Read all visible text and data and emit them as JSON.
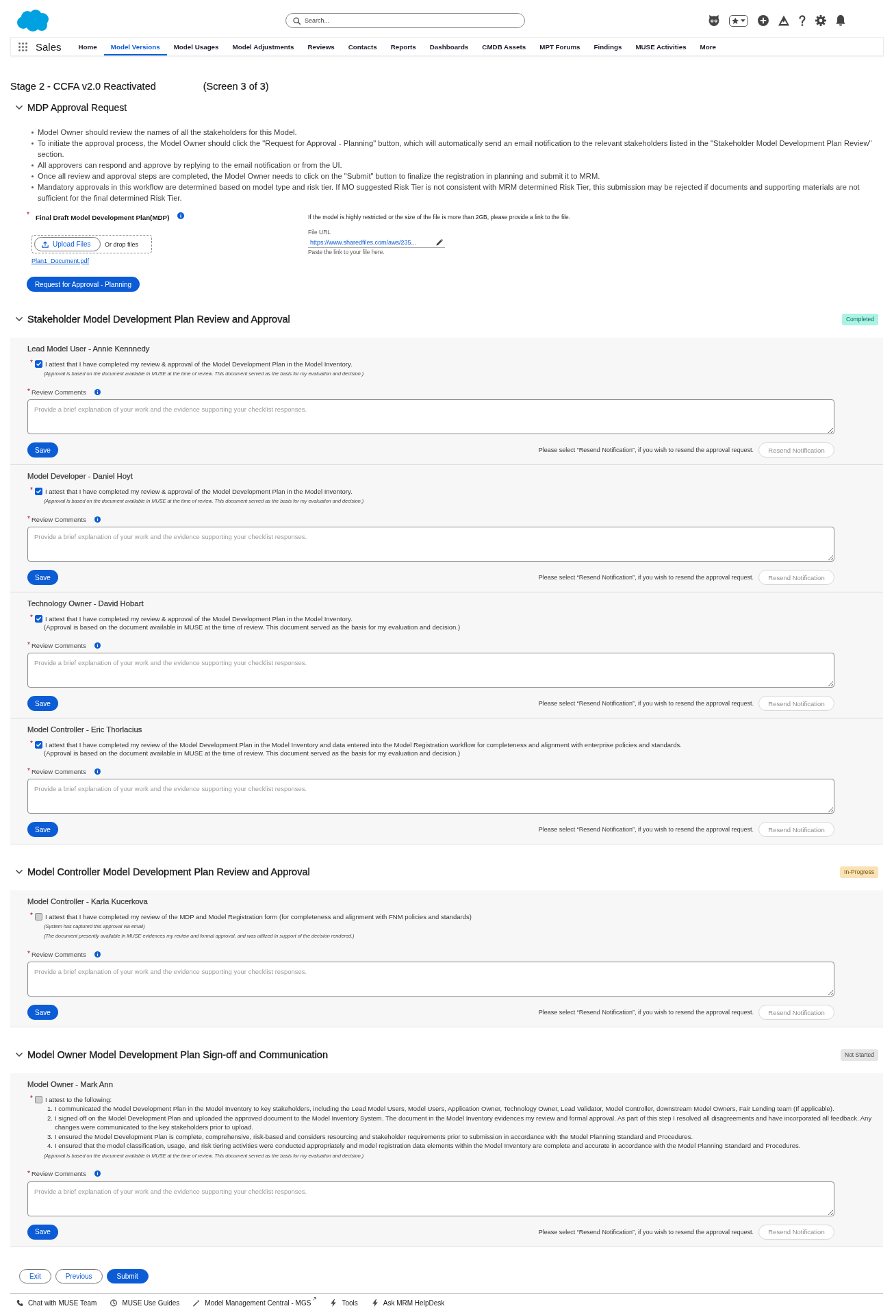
{
  "header": {
    "search": {
      "placeholder": "Search..."
    }
  },
  "nav": {
    "app_name": "Sales",
    "tabs": [
      {
        "label": "Home",
        "selected": false
      },
      {
        "label": "Model Versions",
        "selected": true
      },
      {
        "label": "Model Usages",
        "selected": false
      },
      {
        "label": "Model Adjustments",
        "selected": false
      },
      {
        "label": "Reviews",
        "selected": false
      },
      {
        "label": "Contacts",
        "selected": false
      },
      {
        "label": "Reports",
        "selected": false
      },
      {
        "label": "Dashboards",
        "selected": false
      },
      {
        "label": "CMDB Assets",
        "selected": false
      },
      {
        "label": "MPT Forums",
        "selected": false
      },
      {
        "label": "Findings",
        "selected": false
      },
      {
        "label": "MUSE Activities",
        "selected": false
      },
      {
        "label": "More",
        "selected": false
      }
    ]
  },
  "page": {
    "title": "Stage 2 - CCFA v2.0 Reactivated",
    "screen": "(Screen 3 of 3)"
  },
  "mdp_section": {
    "title": "MDP Approval Request",
    "expanded": true,
    "bullets": [
      "Model Owner should review the names of all the stakeholders for this Model.",
      "To initiate the approval process, the Model Owner should click the \"Request for Approval - Planning\" button, which will automatically send an email notification to the relevant stakeholders listed in the \"Stakeholder Model Development Plan Review\" section.",
      "All approvers can respond and approve by replying to the email notification or from the UI.",
      "Once all review and approval steps are completed, the Model Owner needs to click on the \"Submit\" button to finalize the registration in planning and submit it to MRM.",
      "Mandatory approvals in this workflow are determined based on model type and risk tier. If MO suggested Risk Tier is not consistent with MRM determined Risk Tier, this submission may be rejected if documents and supporting materials are not sufficient for the final determined Risk Tier."
    ],
    "upload": {
      "required_mark": "*",
      "label": "Final Draft Model Development Plan(MDP)",
      "button": "Upload Files",
      "drop_hint": "Or drop files",
      "file": "Plan1_Document.pdf"
    },
    "file_url": {
      "hint": "If the model is highly restricted or the size of the file is more than 2GB, please provide a link to the file.",
      "label": "File URL",
      "value": "https://www.sharedfiles.com/aws/235...",
      "help": "Paste the link to your file here."
    },
    "request_button": "Request for Approval - Planning"
  },
  "approval_sections": [
    {
      "title": "Stakeholder Model Development Plan Review and Approval",
      "expanded": true,
      "status": {
        "label": "Completed",
        "kind": "completed"
      },
      "reviewers": [
        {
          "title": "Lead Model User - Annie Kennnedy",
          "attest": {
            "required_mark": "*",
            "checked": true,
            "text": "I attest that I have completed my review & approval of the Model Development Plan in the Model Inventory."
          },
          "notes": [
            {
              "kind": "fine-print",
              "text": "(Approval is based on the document available in MUSE at the time of review. This document served as the basis for my evaluation and decision.)"
            }
          ],
          "comments": {
            "required_mark": "*",
            "label": "Review Comments",
            "placeholder": "Provide a brief explanation of your work and the evidence supporting your checklist responses."
          },
          "save_button": "Save",
          "resend_hint": "Please select “Resend Notification”, if you wish to resend the approval request.",
          "resend_button": {
            "label": "Resend Notification",
            "disabled": true
          }
        },
        {
          "title": "Model Developer - Daniel Hoyt",
          "attest": {
            "required_mark": "*",
            "checked": true,
            "text": "I attest that I have completed my review & approval of the Model Development Plan in the Model Inventory."
          },
          "notes": [
            {
              "kind": "fine-print",
              "text": "(Approval is based on the document available in MUSE at the time of review. This document served as the basis for my evaluation and decision.)"
            }
          ],
          "comments": {
            "required_mark": "*",
            "label": "Review Comments",
            "placeholder": "Provide a brief explanation of your work and the evidence supporting your checklist responses."
          },
          "save_button": "Save",
          "resend_hint": "Please select “Resend Notification”, if you wish to resend the approval request.",
          "resend_button": {
            "label": "Resend Notification",
            "disabled": true
          }
        },
        {
          "title": "Technology Owner - David Hobart",
          "attest": {
            "required_mark": "*",
            "checked": true,
            "text": "I attest that I have completed my review & approval of the Model Development Plan in the Model Inventory."
          },
          "notes": [
            {
              "kind": "plain",
              "text": "(Approval is based on the document available in MUSE at the time of review. This document served as the basis for my evaluation and decision.)"
            }
          ],
          "comments": {
            "required_mark": "*",
            "label": "Review Comments",
            "placeholder": "Provide a brief explanation of your work and the evidence supporting your checklist responses."
          },
          "save_button": "Save",
          "resend_hint": "Please select “Resend Notification”, if you wish to resend the approval request.",
          "resend_button": {
            "label": "Resend Notification",
            "disabled": true
          }
        },
        {
          "title": "Model Controller - Eric Thorlacius",
          "attest": {
            "required_mark": "*",
            "checked": true,
            "text": "I attest that I have completed my review of the Model Development Plan in the Model Inventory and data entered into the Model Registration workflow for completeness and alignment with enterprise policies and standards."
          },
          "notes": [
            {
              "kind": "plain",
              "text": "(Approval is based on the document available in MUSE at the time of review. This document served as the basis for my evaluation and decision.)"
            }
          ],
          "comments": {
            "required_mark": "*",
            "label": "Review Comments",
            "placeholder": "Provide a brief explanation of your work and the evidence supporting your checklist responses."
          },
          "save_button": "Save",
          "resend_hint": "Please select “Resend Notification”, if you wish to resend the approval request.",
          "resend_button": {
            "label": "Resend Notification",
            "disabled": true
          }
        }
      ]
    },
    {
      "title": "Model Controller Model Development Plan Review and Approval",
      "expanded": true,
      "status": {
        "label": "In-Progress",
        "kind": "in-progress"
      },
      "reviewers": [
        {
          "title": "Model Controller - Karla Kucerkova",
          "attest": {
            "required_mark": "*",
            "checked": false,
            "text": "I attest that I have completed my review of the MDP and Model Registration form (for completeness and alignment with FNM policies and standards)"
          },
          "notes": [
            {
              "kind": "fine-print",
              "text": "(System has captured this approval via email)"
            },
            {
              "kind": "fine-print",
              "text": "(The document presently available in MUSE evidences my review and formal approval, and was utilized in support of the decision rendered.)"
            }
          ],
          "comments": {
            "required_mark": "*",
            "label": "Review Comments",
            "placeholder": "Provide a brief explanation of your work and the evidence supporting your checklist responses."
          },
          "save_button": "Save",
          "resend_hint": "Please select “Resend Notification”, if you wish to resend the approval request.",
          "resend_button": {
            "label": "Resend Notification",
            "disabled": true
          }
        }
      ]
    },
    {
      "title": "Model Owner Model Development Plan Sign-off and Communication",
      "expanded": true,
      "status": {
        "label": "Not Started",
        "kind": "not-started"
      },
      "reviewers": [
        {
          "title": "Model Owner - Mark Ann",
          "attest": {
            "required_mark": "*",
            "checked": false,
            "text": "I attest to the following:",
            "items": [
              {
                "number": "1.",
                "text": "I communicated the Model Development Plan in the Model Inventory to key stakeholders, including the Lead Model Users, Model Users, Application Owner, Technology Owner, Lead Validator, Model Controller, downstream Model Owners, Fair Lending team (If applicable)."
              },
              {
                "number": "2.",
                "text": "I signed off on the Model Development Plan and uploaded the approved document to the Model Inventory System. The document in the Model Inventory evidences my review and formal approval. As part of this step I resolved all disagreements and have incorporated all feedback. Any changes were communicated to the key stakeholders prior to upload."
              },
              {
                "number": "3.",
                "text": "I ensured the Model Development Plan is complete, comprehensive, risk-based and considers resourcing and stakeholder requirements prior to submission in accordance with the Model Planning Standard and Procedures."
              },
              {
                "number": "4.",
                "text": "I ensured that the model classification, usage, and risk tiering activities were conducted appropriately and model registration data elements within the Model Inventory are complete and accurate in accordance with the Model Planning Standard and Procedures."
              }
            ]
          },
          "notes": [
            {
              "kind": "fine-print",
              "text": "(Approval is based on the document available in MUSE at the time of review. This document served as the basis for my evaluation and decision.)"
            }
          ],
          "comments": {
            "required_mark": "*",
            "label": "Review Comments",
            "placeholder": "Provide a brief explanation of your work and the evidence supporting your checklist responses."
          },
          "save_button": "Save",
          "resend_hint": "Please select “Resend Notification”, if you wish to resend the approval request.",
          "resend_button": {
            "label": "Resend Notification",
            "disabled": true
          }
        }
      ]
    }
  ],
  "footer_buttons": [
    {
      "label": "Exit",
      "kind": "outline"
    },
    {
      "label": "Previous",
      "kind": "outline"
    },
    {
      "label": "Submit",
      "kind": "brand"
    }
  ],
  "utility_bar": [
    {
      "kind": "phone",
      "label": "Chat with MUSE Team",
      "external": false
    },
    {
      "kind": "clock",
      "label": "MUSE Use Guides",
      "external": false
    },
    {
      "kind": "wand",
      "label": "Model Management Central - MGS",
      "external": true
    },
    {
      "kind": "lightning",
      "label": "Tools",
      "external": false
    },
    {
      "kind": "lightning",
      "label": "Ask MRM HelpDesk",
      "external": false
    }
  ]
}
